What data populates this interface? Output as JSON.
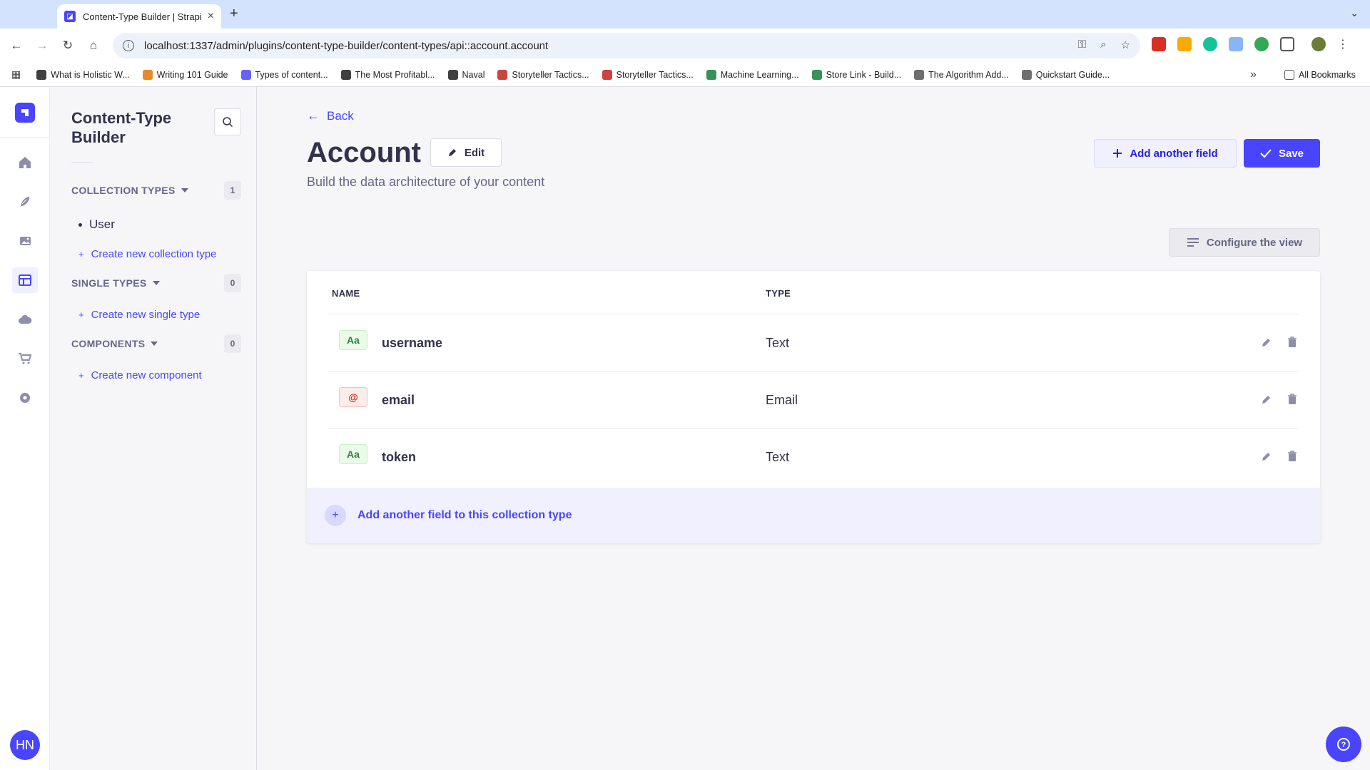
{
  "browser": {
    "tab_title": "Content-Type Builder | Strapi",
    "url": "localhost:1337/admin/plugins/content-type-builder/content-types/api::account.account",
    "bookmarks": [
      {
        "label": "What is Holistic W...",
        "icon": "H"
      },
      {
        "label": "Writing 101 Guide",
        "icon": "pen"
      },
      {
        "label": "Types of content...",
        "icon": "c"
      },
      {
        "label": "The Most Profitabl...",
        "icon": "TV"
      },
      {
        "label": "Naval",
        "icon": "N"
      },
      {
        "label": "Storyteller Tactics...",
        "icon": "s"
      },
      {
        "label": "Storyteller Tactics...",
        "icon": "s"
      },
      {
        "label": "Machine Learning...",
        "icon": "m"
      },
      {
        "label": "Store Link - Build...",
        "icon": "bag"
      },
      {
        "label": "The Algorithm Add...",
        "icon": "IC"
      },
      {
        "label": "Quickstart Guide...",
        "icon": "doc"
      }
    ],
    "all_bookmarks": "All Bookmarks",
    "more": "»"
  },
  "mainnav": {
    "avatar_initials": "HN"
  },
  "subnav": {
    "title": "Content-Type Builder",
    "collection_types": {
      "label": "COLLECTION TYPES",
      "count": "1",
      "items": [
        "User"
      ],
      "create": "Create new collection type"
    },
    "single_types": {
      "label": "SINGLE TYPES",
      "count": "0",
      "create": "Create new single type"
    },
    "components": {
      "label": "COMPONENTS",
      "count": "0",
      "create": "Create new component"
    }
  },
  "header": {
    "back": "Back",
    "title": "Account",
    "edit": "Edit",
    "subtitle": "Build the data architecture of your content",
    "add_field": "Add another field",
    "save": "Save",
    "configure": "Configure the view"
  },
  "table": {
    "col_name": "NAME",
    "col_type": "TYPE",
    "rows": [
      {
        "icon": "Aa",
        "kind": "text",
        "name": "username",
        "type": "Text"
      },
      {
        "icon": "@",
        "kind": "email",
        "name": "email",
        "type": "Email"
      },
      {
        "icon": "Aa",
        "kind": "text",
        "name": "token",
        "type": "Text"
      }
    ],
    "footer_add": "Add another field to this collection type"
  },
  "colors": {
    "primary": "#4945ff",
    "text": "#32324d",
    "muted": "#666687"
  }
}
